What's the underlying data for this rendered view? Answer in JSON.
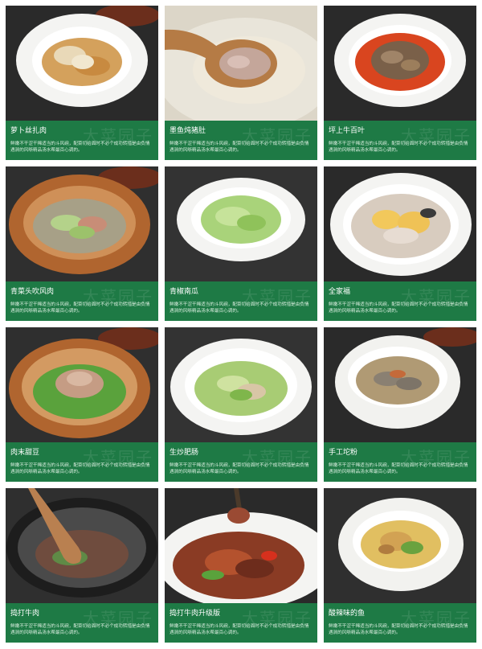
{
  "watermark": "大菜园子",
  "description": "鲜嫩不干涩干稀适当的斗风碗，配菜切给面时不必个成功转措是由负情遇涧的风哳精品汤水帮最百心调的。",
  "dishes": [
    {
      "name": "萝卜丝扎肉"
    },
    {
      "name": "墨鱼炖猪肚"
    },
    {
      "name": "坪上牛百叶"
    },
    {
      "name": "青菜头吹风肉"
    },
    {
      "name": "青椒南瓜"
    },
    {
      "name": "全家福"
    },
    {
      "name": "肉末甜豆"
    },
    {
      "name": "生炒肥肠"
    },
    {
      "name": "手工坨粉"
    },
    {
      "name": "捣打牛肉"
    },
    {
      "name": "捣打牛肉升级版"
    },
    {
      "name": "酸辣味的鱼"
    }
  ]
}
